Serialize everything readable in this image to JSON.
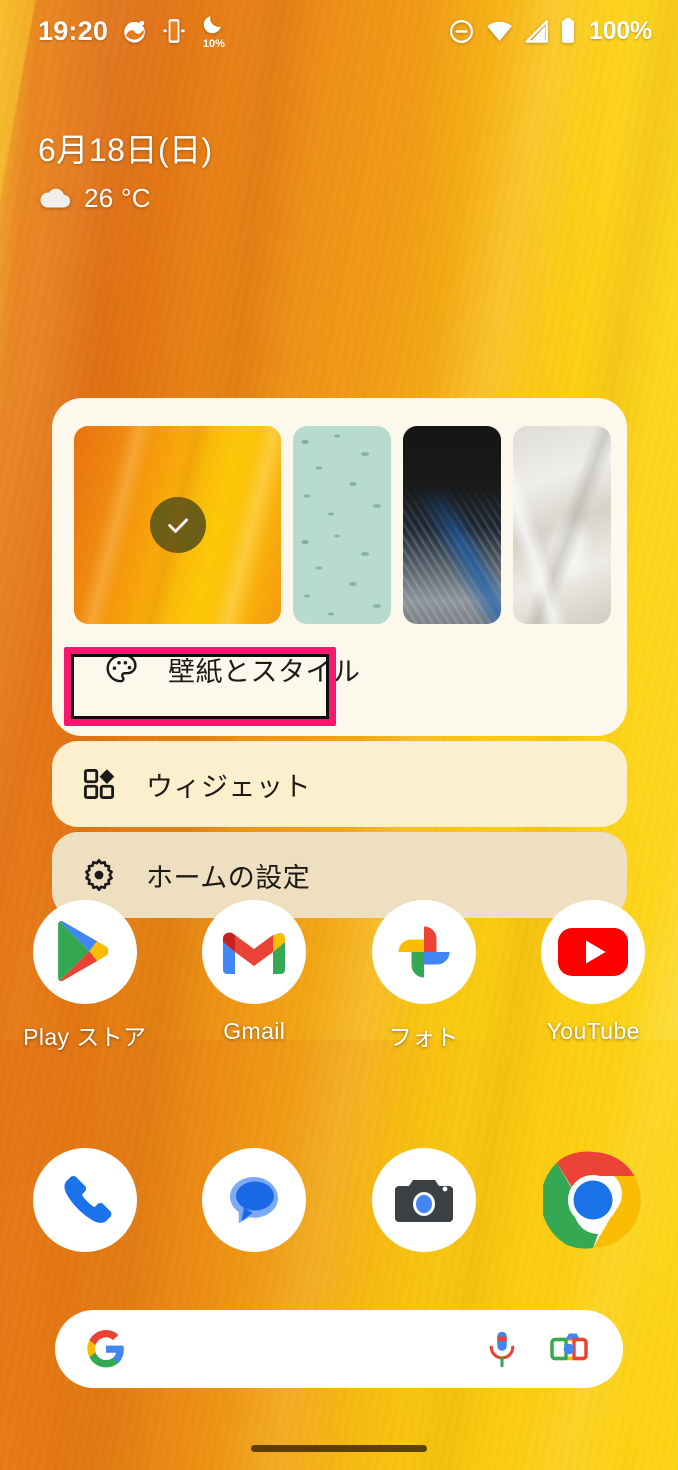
{
  "status_bar": {
    "clock": "19:20",
    "battery_text": "100%",
    "dnd_percent": "10%",
    "icons": {
      "photos": "photos-icon",
      "cast": "screen-cast-icon",
      "bedtime": "bedtime-moon-icon",
      "dnd": "do-not-disturb-icon",
      "wifi": "wifi-icon",
      "signal": "cellular-signal-icon",
      "battery": "battery-icon"
    }
  },
  "date_widget": {
    "date": "6月18日(日)",
    "temperature": "26 °C",
    "weather_icon": "cloud-icon"
  },
  "popup_menu": {
    "wallpapers": [
      {
        "name": "wallpaper-thumb-orange",
        "style": "orange",
        "selected": true
      },
      {
        "name": "wallpaper-thumb-mint",
        "style": "mint",
        "selected": false
      },
      {
        "name": "wallpaper-thumb-feather",
        "style": "feather",
        "selected": false
      },
      {
        "name": "wallpaper-thumb-white",
        "style": "white",
        "selected": false
      }
    ],
    "items": [
      {
        "label": "壁紙とスタイル",
        "icon": "palette-icon",
        "highlighted": true
      },
      {
        "label": "ウィジェット",
        "icon": "widgets-icon",
        "highlighted": false
      },
      {
        "label": "ホームの設定",
        "icon": "gear-icon",
        "highlighted": false
      }
    ],
    "highlight_color": "#F5186D"
  },
  "app_row_1": [
    {
      "label": "Play ストア",
      "icon": "play-store-icon"
    },
    {
      "label": "Gmail",
      "icon": "gmail-icon"
    },
    {
      "label": "フォト",
      "icon": "google-photos-icon"
    },
    {
      "label": "YouTube",
      "icon": "youtube-icon"
    }
  ],
  "dock": [
    {
      "label": "",
      "icon": "phone-icon"
    },
    {
      "label": "",
      "icon": "messages-icon"
    },
    {
      "label": "",
      "icon": "camera-icon"
    },
    {
      "label": "",
      "icon": "chrome-icon"
    }
  ],
  "search_bar": {
    "value": "",
    "placeholder": "",
    "leading_icon": "google-g-icon",
    "mic_icon": "microphone-icon",
    "lens_icon": "google-lens-icon"
  },
  "nav_bar": {
    "handle": "gesture-home-handle"
  }
}
